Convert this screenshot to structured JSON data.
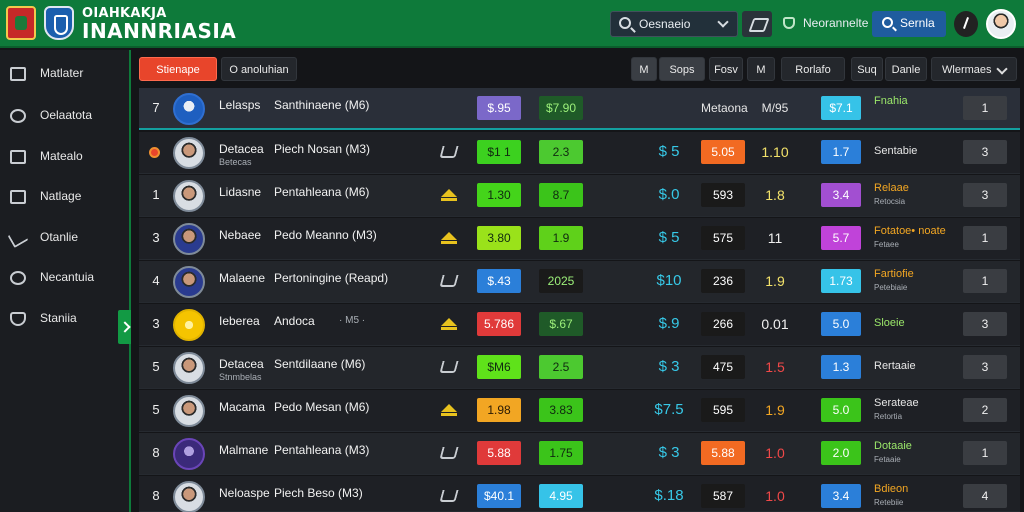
{
  "header": {
    "brand_top": "OIAHKAKJA",
    "brand_main": "INANNRIASIA",
    "search_label": "Oesnaeio",
    "badge_label": "Neorannelte",
    "search_button_label": "Sernla"
  },
  "sidebar": {
    "items": [
      {
        "label": "Matlater"
      },
      {
        "label": "Oelaatota"
      },
      {
        "label": "Matealo"
      },
      {
        "label": "Natlage"
      },
      {
        "label": "Otanlie"
      },
      {
        "label": "Necantuia"
      },
      {
        "label": "Staniia"
      }
    ]
  },
  "toolbar": {
    "primary": "Stienape",
    "secondary": "O anoluhian",
    "g1": "M",
    "g2": "Sops",
    "b3": "Fosv",
    "b4": "M",
    "b5": "Rorlafo",
    "b6a": "Suq",
    "b6b": "Danle",
    "dropdown": "Wlermaes"
  },
  "rows": [
    {
      "rank": "7",
      "short": "Lelasps",
      "sub": "",
      "full": "Santhinaene (M6)",
      "extra": "",
      "c1": "$.95",
      "c2": "$7.90",
      "c3": "",
      "c4": "Metaona",
      "c5": "M/95",
      "c6": "$7.1",
      "status": "Fnahia",
      "status2": "",
      "num": "1"
    },
    {
      "rank": "",
      "short": "Detacea",
      "sub": "Betecas",
      "full": "Piech Nosan (M3)",
      "extra": "",
      "c1": "$1 1",
      "c2": "2.3",
      "c3": "$ 5",
      "c4": "5.05",
      "c5": "1.10",
      "c6": "1.7",
      "status": "Sentabie",
      "status2": "",
      "num": "3"
    },
    {
      "rank": "1",
      "short": "Lidasne",
      "sub": "",
      "full": "Pentahleana (M6)",
      "extra": "",
      "c1": "1.30",
      "c2": "8.7",
      "c3": "$.0",
      "c4": "593",
      "c5": "1.8",
      "c6": "3.4",
      "status": "Relaae",
      "status2": "Retocsia",
      "num": "3"
    },
    {
      "rank": "3",
      "short": "Nebaee",
      "sub": "",
      "full": "Pedo Meanno (M3)",
      "extra": "",
      "c1": "3.80",
      "c2": "1.9",
      "c3": "$ 5",
      "c4": "575",
      "c5": "11",
      "c6": "5.7",
      "status": "Fotatoe• noate",
      "status2": "Fetaee",
      "num": "1"
    },
    {
      "rank": "4",
      "short": "Malaene",
      "sub": "",
      "full": "Pertoningine (Reapd)",
      "extra": "",
      "c1": "$.43",
      "c2": "2025",
      "c3": "$10",
      "c4": "236",
      "c5": "1.9",
      "c6": "1.73",
      "status": "Fartiofie",
      "status2": "Petebiaie",
      "num": "1"
    },
    {
      "rank": "3",
      "short": "Ieberea",
      "sub": "",
      "full": "Andoca",
      "extra": "· M5 ·",
      "c1": "5.786",
      "c2": "$.67",
      "c3": "$.9",
      "c4": "266",
      "c5": "0.01",
      "c6": "5.0",
      "status": "Sloeie",
      "status2": "",
      "num": "3"
    },
    {
      "rank": "5",
      "short": "Detacea",
      "sub": "Stnmbelas",
      "full": "Sentdilaane (M6)",
      "extra": "",
      "c1": "$M6",
      "c2": "2.5",
      "c3": "$ 3",
      "c4": "475",
      "c5": "1.5",
      "c6": "1.3",
      "status": "Rertaaie",
      "status2": "",
      "num": "3"
    },
    {
      "rank": "5",
      "short": "Macama",
      "sub": "",
      "full": "Pedo Mesan (M6)",
      "extra": "",
      "c1": "1.98",
      "c2": "3.83",
      "c3": "$7.5",
      "c4": "595",
      "c5": "1.9",
      "c6": "5.0",
      "status": "Serateae",
      "status2": "Retortia",
      "num": "2"
    },
    {
      "rank": "8",
      "short": "Malmane",
      "sub": "",
      "full": "Pentahleana (M3)",
      "extra": "",
      "c1": "5.88",
      "c2": "1.75",
      "c3": "$ 3",
      "c4": "5.88",
      "c5": "1.0",
      "c6": "2.0",
      "status": "Dotaaie",
      "status2": "Fetaaie",
      "num": "1"
    },
    {
      "rank": "8",
      "short": "Neloaspe",
      "sub": "",
      "full": "Piech Beso (M3)",
      "extra": "",
      "c1": "$40.1",
      "c2": "4.95",
      "c3": "$.18",
      "c4": "587",
      "c5": "1.0",
      "c6": "3.4",
      "status": "Bdieon",
      "status2": "Retebiie",
      "num": "4"
    }
  ],
  "colors": {
    "header_green": "#0e7a3a",
    "accent_orange": "#e8452b",
    "teal_highlight": "#13a0a0"
  }
}
